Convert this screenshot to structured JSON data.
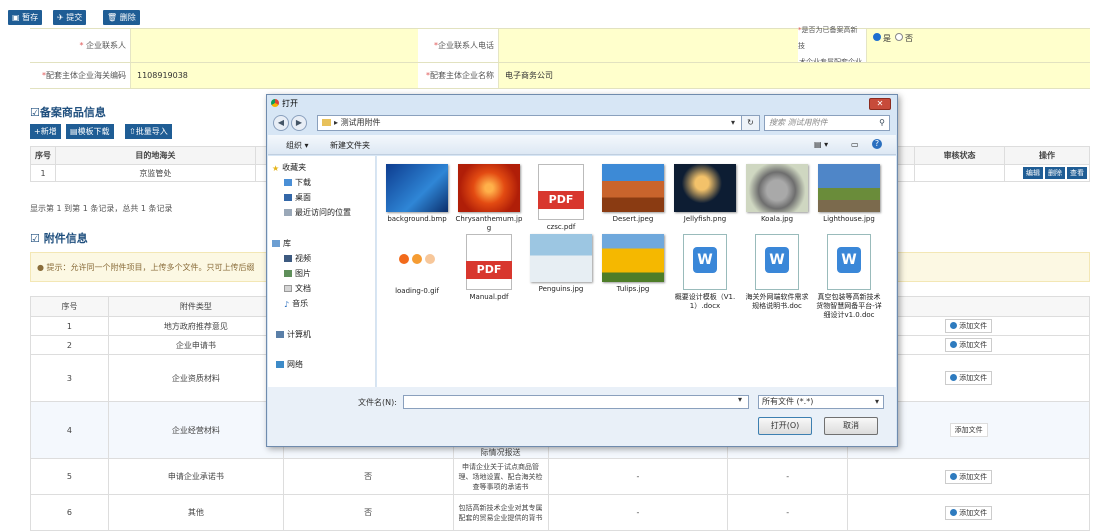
{
  "toolbar": {
    "save": "暂存",
    "submit": "提交",
    "delete": "删除"
  },
  "form": {
    "contact_label": "企业联系人",
    "contact_value": "",
    "phone_label": "企业联系人电话",
    "phone_value": "",
    "hightech_label_1": "是否为已备案高新技",
    "hightech_label_2": "术企业专属配套企业",
    "hightech_yes": "是",
    "hightech_no": "否",
    "customs_code_label": "配套主体企业海关编码",
    "customs_code_value": "1108919038",
    "company_name_label": "配套主体企业名称",
    "company_name_value": "电子商务公司"
  },
  "goods": {
    "title": "备案商品信息",
    "add": "新增",
    "template": "模板下载",
    "import": "批量导入",
    "headers": [
      "序号",
      "目的地海关",
      "审核状态",
      "操作"
    ],
    "row": {
      "index": "1",
      "customs": "京监管处",
      "status": ""
    },
    "actions": [
      "编辑",
      "删除",
      "查看"
    ],
    "summary": "显示第 1 到第 1 条记录，总共 1 条记录"
  },
  "attach": {
    "title": "附件信息",
    "tip": "提示：允许同一个附件项目，上传多个文件。只可上传后缀",
    "headers": [
      "序号",
      "附件类型"
    ],
    "rows": [
      {
        "idx": "1",
        "type": "地方政府推荐意见",
        "req": "",
        "desc": "",
        "a": "",
        "b": "",
        "btn": "添加文件"
      },
      {
        "idx": "2",
        "type": "企业申请书",
        "req": "",
        "desc": "",
        "a": "",
        "b": "",
        "btn": "添加文件"
      },
      {
        "idx": "3",
        "type": "企业资质材料",
        "req": "",
        "desc": "",
        "a": "",
        "b": "",
        "btn": "添加文件"
      },
      {
        "idx": "4",
        "type": "企业经营材料",
        "req": "",
        "desc": "",
        "a": "",
        "b": "",
        "btn": "添加文件"
      },
      {
        "idx": "5",
        "type": "申请企业承诺书",
        "req": "否",
        "desc": "申请企业关于试点商品管理、场地设置、配合海关检查等事项的承诺书",
        "a": "-",
        "b": "-",
        "btn": "添加文件"
      },
      {
        "idx": "6",
        "type": "其他",
        "req": "否",
        "desc": "包括高新技术企业对其专属配套的贸易企业提供的背书",
        "a": "-",
        "b": "-",
        "btn": "添加文件"
      }
    ],
    "row4_extra": "际情况报送"
  },
  "dialog": {
    "title": "打开",
    "address": "测试用附件",
    "search_placeholder": "搜索 测试用附件",
    "organize": "组织 ▾",
    "new_folder": "新建文件夹",
    "nav": [
      "收藏夹",
      "下载",
      "桌面",
      "最近访问的位置",
      "库",
      "视频",
      "图片",
      "文档",
      "音乐",
      "计算机",
      "网络"
    ],
    "files": [
      {
        "name": "background.bmp",
        "kind": "blue"
      },
      {
        "name": "Chrysanthemum.jpg",
        "kind": "flower"
      },
      {
        "name": "czsc.pdf",
        "kind": "pdf"
      },
      {
        "name": "Desert.jpeg",
        "kind": "desert"
      },
      {
        "name": "Jellyfish.png",
        "kind": "jelly"
      },
      {
        "name": "Koala.jpg",
        "kind": "koala"
      },
      {
        "name": "Lighthouse.jpg",
        "kind": "light"
      },
      {
        "name": "loading-0.gif",
        "kind": "gif"
      },
      {
        "name": "Manual.pdf",
        "kind": "pdf"
      },
      {
        "name": "Penguins.jpg",
        "kind": "peng"
      },
      {
        "name": "Tulips.jpg",
        "kind": "tulip"
      },
      {
        "name": "概要设计模板（V1.1）.docx",
        "kind": "word"
      },
      {
        "name": "海关外网端软件需求规格说明书.doc",
        "kind": "word"
      },
      {
        "name": "真空包装等高新技术货物智慧网备平台-详细设计v1.0.doc",
        "kind": "word"
      }
    ],
    "filename_label": "文件名(N):",
    "filename_value": "",
    "filetype": "所有文件 (*.*)",
    "open": "打开(O)",
    "cancel": "取消"
  },
  "colors": {
    "accent": "#1f5d95",
    "yellow": "#ffffcc"
  }
}
